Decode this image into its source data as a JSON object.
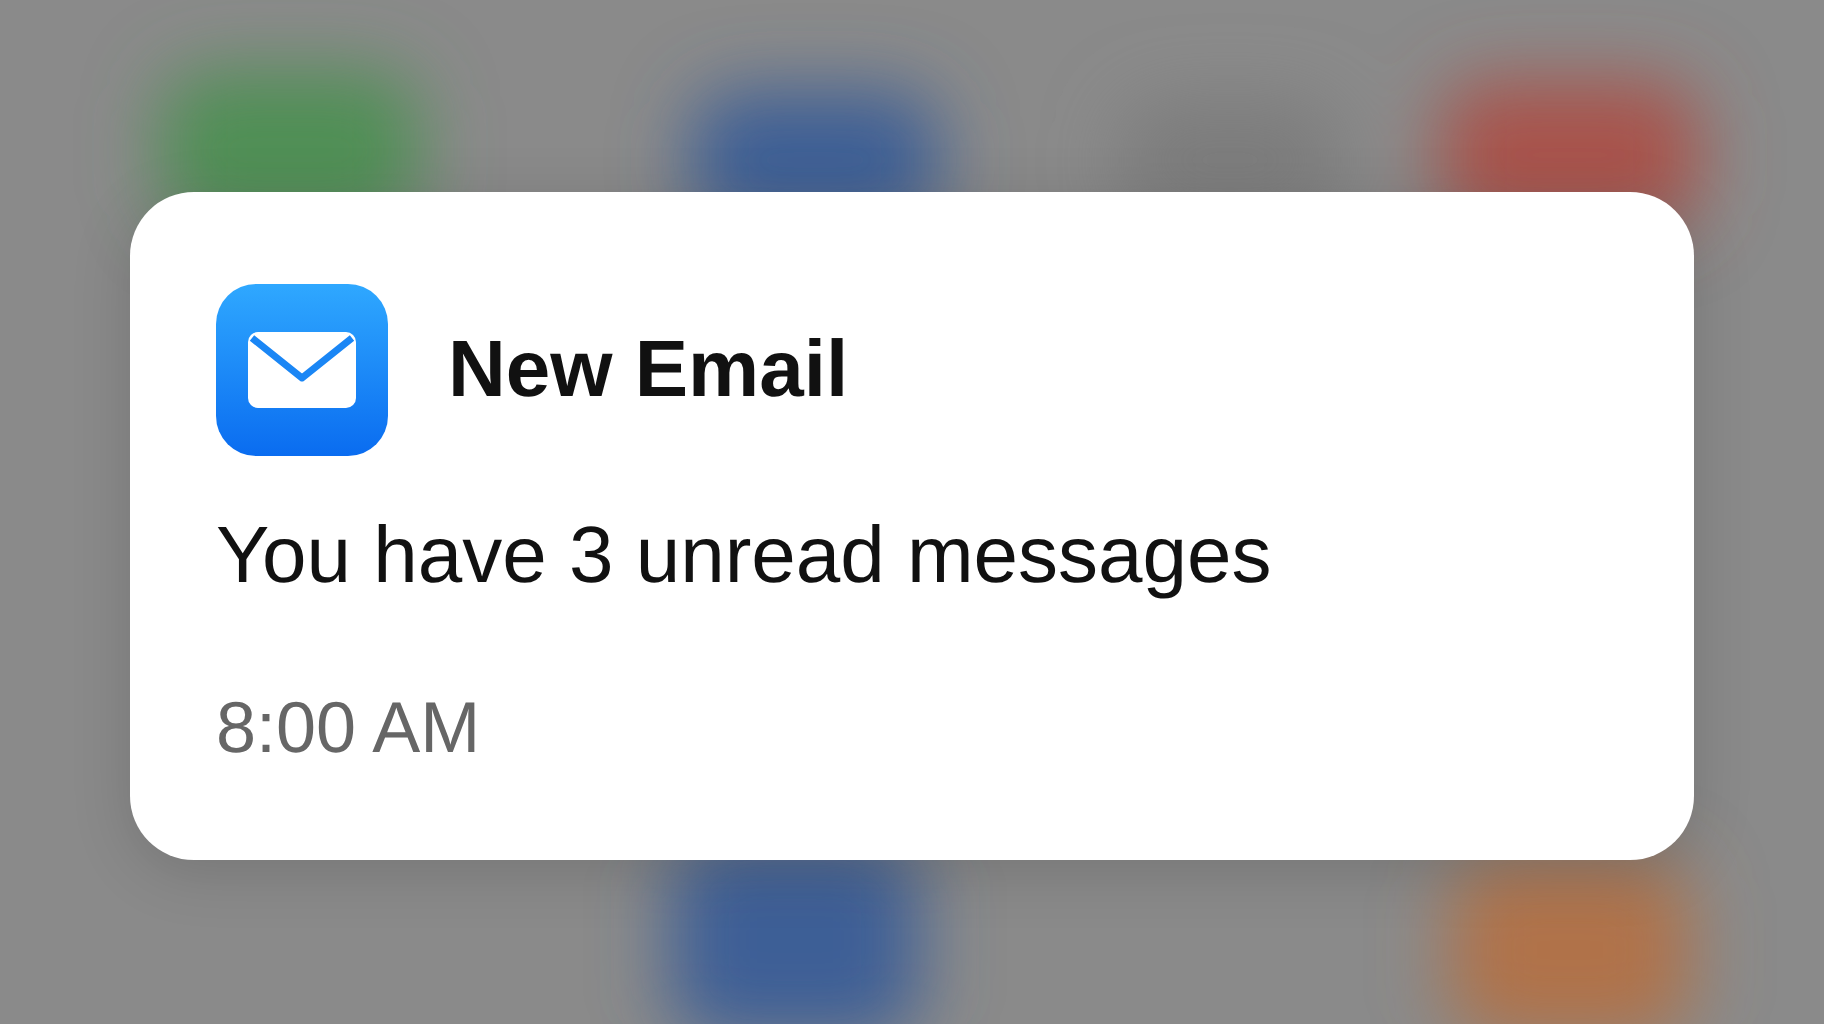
{
  "notification": {
    "title": "New Email",
    "message": "You have 3 unread messages",
    "time": "8:00 AM"
  }
}
